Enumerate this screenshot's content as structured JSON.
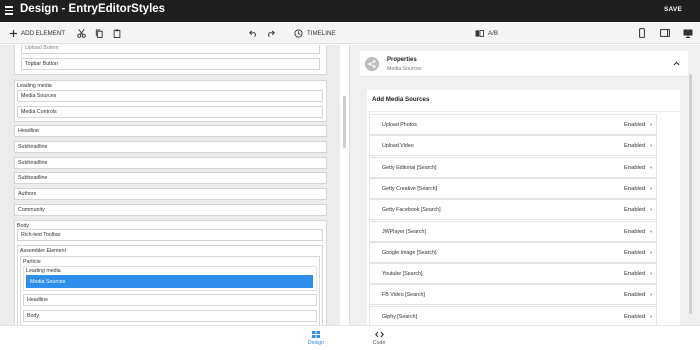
{
  "app": {
    "title": "Design - EntryEditorStyles",
    "save_label": "SAVE"
  },
  "toolbar": {
    "add_element_label": "ADD ELEMENT",
    "timeline_label": "TIMELINE",
    "ab_label": "A/B"
  },
  "tree": {
    "upload_button": "Upload Button",
    "topbar_button": "Topbar Button",
    "leading_media": "Leading media",
    "media_sources": "Media Sources",
    "media_controls": "Media Controls",
    "headline": "Headline",
    "subheadline_1": "Subheadline",
    "subheadline_2": "Subheadline",
    "subheadline_3": "Subheadline",
    "authors": "Authors",
    "community": "Community",
    "body": "Body",
    "richtext_toolbar": "Rich-text Toolbar",
    "assembler_element": "Assembler Element",
    "particle": "Particle",
    "particle_leading_media": "Leading media",
    "particle_media_sources": "Media Sources",
    "particle_headline": "Headline",
    "particle_body": "Body"
  },
  "properties": {
    "title": "Properties",
    "subtitle": "Media Sources"
  },
  "add_media": {
    "heading": "Add Media Sources",
    "sources": [
      {
        "name": "Upload Photos",
        "value": "Enabled"
      },
      {
        "name": "Upload Video",
        "value": "Enabled"
      },
      {
        "name": "Getty Editorial [Search]",
        "value": "Enabled"
      },
      {
        "name": "Getty Creative [Search]",
        "value": "Enabled"
      },
      {
        "name": "Getty Facebook [Search]",
        "value": "Enabled"
      },
      {
        "name": "JWPlayer [Search]",
        "value": "Enabled"
      },
      {
        "name": "Google Image [Search]",
        "value": "Enabled"
      },
      {
        "name": "Youtube [Search]",
        "value": "Enabled"
      },
      {
        "name": "FB Video [Search]",
        "value": "Enabled"
      },
      {
        "name": "Giphy [Search]",
        "value": "Enabled"
      }
    ]
  },
  "bottom": {
    "design_label": "Design",
    "code_label": "Code"
  },
  "colors": {
    "accent": "#2e8fec",
    "topbar": "#1f1f1f"
  }
}
